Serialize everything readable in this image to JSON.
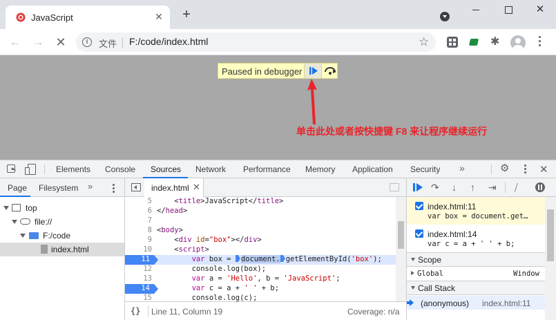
{
  "browser": {
    "tab_title": "JavaScript",
    "tab_close": "✕",
    "new_tab": "+",
    "omnibox_scheme": "文件",
    "omnibox_url": "F:/code/index.html"
  },
  "overlay": {
    "paused_text": "Paused in debugger",
    "annotation": "单击此处或者按快捷键 F8 来让程序继续运行",
    "annotation_color": "#e8242b",
    "paused_bg": "#ffffc2"
  },
  "devtools": {
    "tabs": [
      "Elements",
      "Console",
      "Sources",
      "Network",
      "Performance",
      "Memory",
      "Application",
      "Security"
    ],
    "active_tab": "Sources",
    "more": "»",
    "close": "✕",
    "navigator": {
      "tabs": [
        "Page",
        "Filesystem"
      ],
      "active_tab": "Page",
      "more": "»",
      "tree": [
        {
          "label": "top",
          "icon": "frame-icon",
          "depth": 0
        },
        {
          "label": "file://",
          "icon": "cloud-icon",
          "depth": 1
        },
        {
          "label": "F:/code",
          "icon": "folder-icon",
          "depth": 2
        },
        {
          "label": "index.html",
          "icon": "file-icon",
          "depth": 3,
          "selected": true
        }
      ]
    },
    "editor": {
      "file_tab": "index.html",
      "file_tab_close": "✕",
      "lines": [
        {
          "num": "5",
          "text": "    <title>JavaScript</title>"
        },
        {
          "num": "6",
          "text": "</head>"
        },
        {
          "num": "7",
          "text": ""
        },
        {
          "num": "8",
          "text": "<body>"
        },
        {
          "num": "9",
          "text": "    <div id=\"box\"></div>"
        },
        {
          "num": "10",
          "text": "    <script>"
        },
        {
          "num": "11",
          "text": "        var box = document.getElementById('box');",
          "breakpoint": true,
          "current": true
        },
        {
          "num": "12",
          "text": "        console.log(box);"
        },
        {
          "num": "13",
          "text": "        var a = 'Hello', b = 'JavaScript';"
        },
        {
          "num": "14",
          "text": "        var c = a + ' ' + b;",
          "breakpoint": true
        },
        {
          "num": "15",
          "text": "        console.log(c);"
        }
      ],
      "status_braces": "{}",
      "status_position": "Line 11, Column 19",
      "status_coverage": "Coverage: n/a"
    },
    "debugger": {
      "breakpoints": [
        {
          "file": "index.html:11",
          "code": "var box = document.get…",
          "paused": true
        },
        {
          "file": "index.html:14",
          "code": "var c = a + ' ' + b;",
          "paused": false
        }
      ],
      "scope_label": "Scope",
      "scope_items": [
        {
          "name": "Global",
          "value": "Window"
        }
      ],
      "callstack_label": "Call Stack",
      "frames": [
        {
          "name": "(anonymous)",
          "location": "index.html:11"
        }
      ]
    }
  }
}
